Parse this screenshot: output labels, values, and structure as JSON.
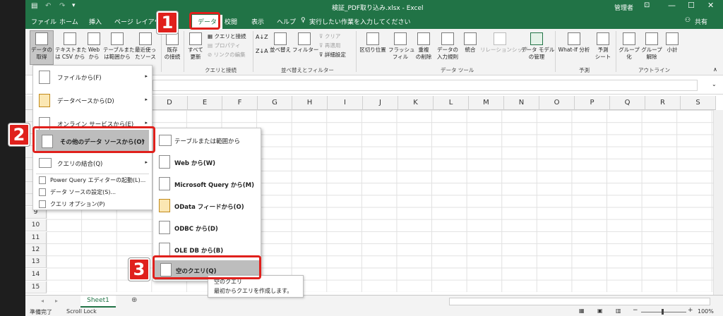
{
  "titlebar": {
    "title": "検証_PDF取り込み.xlsx - Excel",
    "user": "管理者",
    "share": "共有"
  },
  "tabs": [
    "ファイル",
    "ホーム",
    "挿入",
    "ページ レイアウト",
    "データ",
    "校閲",
    "表示",
    "ヘルプ"
  ],
  "tell_me": "実行したい作業を入力してください",
  "ribbon": {
    "get_data": "データの\n取得",
    "text_csv": "テキストまた\nは CSV から",
    "web": "Web\nから",
    "from_table": "テーブルまた\nは範囲から",
    "recent": "最近使っ\nたソース",
    "existing": "既存\nの接続",
    "refresh_all": "すべて\n更新",
    "queries_conn": "クエリと接続",
    "properties": "プロパティ",
    "edit_links": "リンクの編集",
    "sort": "並べ替え",
    "filter": "フィルター",
    "clear": "クリア",
    "reapply": "再適用",
    "advanced": "詳細設定",
    "text_to_col": "区切り位置",
    "flash_fill": "フラッシュ\nフィル",
    "remove_dup": "重複\nの削除",
    "data_val": "データの\n入力規則",
    "consolidate": "統合",
    "relationships": "リレーションシップ",
    "data_model": "データ モデル\nの管理",
    "whatif": "What-If 分析",
    "forecast": "予測\nシート",
    "group": "グループ\n化",
    "ungroup": "グループ\n解除",
    "subtotal": "小計",
    "groups": [
      "クエリと接続",
      "並べ替えとフィルター",
      "データ ツール",
      "予測",
      "アウトライン"
    ]
  },
  "columns": [
    "D",
    "E",
    "F",
    "G",
    "H",
    "I",
    "J",
    "K",
    "L",
    "M",
    "N",
    "O",
    "P",
    "Q",
    "R",
    "S"
  ],
  "rows": [
    "9",
    "10",
    "11",
    "12",
    "13",
    "14",
    "15"
  ],
  "menu": {
    "items": [
      {
        "label": "ファイルから(F)",
        "arrow": "▸"
      },
      {
        "label": "データベースから(D)",
        "arrow": "▸"
      },
      {
        "label": "オンライン サービスから(E)",
        "arrow": "▸"
      },
      {
        "label": "その他のデータ ソースから(O)",
        "arrow": "▸"
      },
      {
        "label": "クエリの結合(Q)",
        "arrow": "▸"
      }
    ],
    "small": [
      "Power Query エディターの起動(L)...",
      "データ ソースの設定(S)...",
      "クエリ オプション(P)"
    ]
  },
  "submenu": [
    "テーブルまたは範囲から",
    "Web から(W)",
    "Microsoft Query から(M)",
    "OData フィードから(O)",
    "ODBC から(D)",
    "OLE DB から(B)",
    "空のクエリ(Q)"
  ],
  "tooltip": {
    "title": "空のクエリ",
    "desc": "最初からクエリを作成します。"
  },
  "badges": [
    "1",
    "2",
    "3"
  ],
  "sheet_tab": "Sheet1",
  "status": {
    "ready": "準備完了",
    "scroll_lock": "Scroll Lock",
    "zoom": "100%"
  },
  "colors": {
    "accent": "#217346",
    "badge": "#e0201c",
    "highlight": "#bdbdbd"
  }
}
